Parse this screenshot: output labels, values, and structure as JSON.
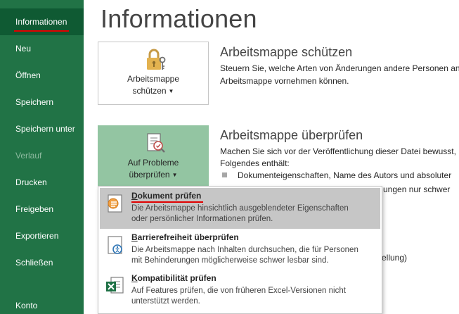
{
  "sidebar": {
    "items": [
      {
        "label": "Informationen",
        "state": "active"
      },
      {
        "label": "Neu",
        "state": "normal"
      },
      {
        "label": "Öffnen",
        "state": "normal"
      },
      {
        "label": "Speichern",
        "state": "normal"
      },
      {
        "label": "Speichern unter",
        "state": "normal"
      },
      {
        "label": "Verlauf",
        "state": "disabled"
      },
      {
        "label": "Drucken",
        "state": "normal"
      },
      {
        "label": "Freigeben",
        "state": "normal"
      },
      {
        "label": "Exportieren",
        "state": "normal"
      },
      {
        "label": "Schließen",
        "state": "normal"
      },
      {
        "label": "Konto",
        "state": "normal"
      }
    ],
    "background_color": "#217346",
    "active_color": "#0f5a33"
  },
  "main": {
    "title": "Informationen",
    "protect": {
      "button_line1": "Arbeitsmappe",
      "button_line2": "schützen",
      "title": "Arbeitsmappe schützen",
      "desc_line1": "Steuern Sie, welche Arten von Änderungen andere Personen an",
      "desc_line2": "Arbeitsmappe vornehmen können.",
      "icon": "lock-key-icon"
    },
    "inspect": {
      "button_line1": "Auf Probleme",
      "button_line2": "überprüfen",
      "title": "Arbeitsmappe überprüfen",
      "desc_line1": "Machen Sie sich vor der Veröffentlichung dieser Datei bewusst,",
      "desc_line2": "Folgendes enthält:",
      "bullet1": "Dokumenteigenschaften, Name des Autors und absoluter",
      "bullet2_fragment": "ungen nur schwer",
      "fragment3": "ellung)",
      "icon": "inspect-document-icon"
    }
  },
  "dropdown": {
    "items": [
      {
        "mnemonic": "D",
        "rest": "okument prüfen",
        "desc_line1": "Die Arbeitsmappe hinsichtlich ausgeblendeter Eigenschaften",
        "desc_line2": "oder persönlicher Informationen prüfen.",
        "icon": "document-inspector-icon",
        "highlighted": true
      },
      {
        "mnemonic": "B",
        "rest": "arrierefreiheit überprüfen",
        "desc_line1": "Die Arbeitsmappe nach Inhalten durchsuchen, die für Personen",
        "desc_line2": "mit Behinderungen möglicherweise schwer lesbar sind.",
        "icon": "accessibility-checker-icon",
        "highlighted": false
      },
      {
        "mnemonic": "K",
        "rest": "ompatibilität prüfen",
        "desc_line1": "Auf Features prüfen, die von früheren Excel-Versionen nicht",
        "desc_line2": "unterstützt werden.",
        "icon": "compatibility-checker-icon",
        "highlighted": false
      }
    ]
  },
  "annotation_color": "#e00000"
}
